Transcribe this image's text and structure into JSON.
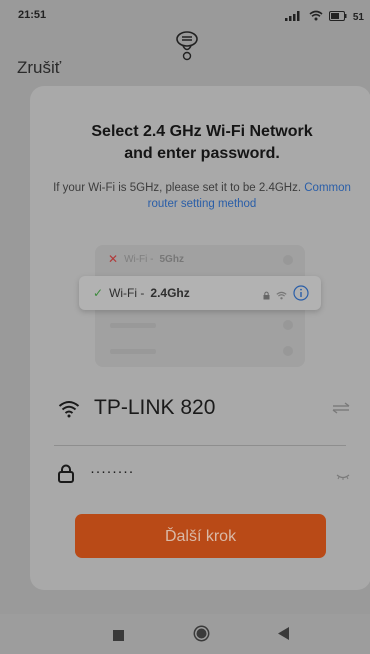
{
  "status_bar": {
    "time": "21:51",
    "battery": "51"
  },
  "header": {
    "cancel_label": "Zrušiť"
  },
  "content": {
    "title_line1": "Select 2.4 GHz Wi-Fi Network",
    "title_line2": "and enter password.",
    "hint_text": "If your Wi-Fi is 5GHz, please set it to be 2.4GHz.",
    "hint_link": "Common router setting method"
  },
  "illustration": {
    "row1_prefix": "Wi-Fi - ",
    "row1_band": "5Ghz",
    "row2_prefix": "Wi-Fi - ",
    "row2_band": "2.4Ghz"
  },
  "form": {
    "ssid": "TP-LINK 820",
    "password_mask": "········"
  },
  "actions": {
    "next_label": "Ďalší krok"
  },
  "colors": {
    "accent": "#b94a17",
    "link": "#2a5ea8"
  },
  "icons": [
    "signal-icon",
    "wifi-icon",
    "battery-icon",
    "notification-icon",
    "lock-icon",
    "info-icon",
    "swap-icon",
    "eye-icon",
    "nav-square-icon",
    "nav-circle-icon",
    "nav-back-icon"
  ]
}
